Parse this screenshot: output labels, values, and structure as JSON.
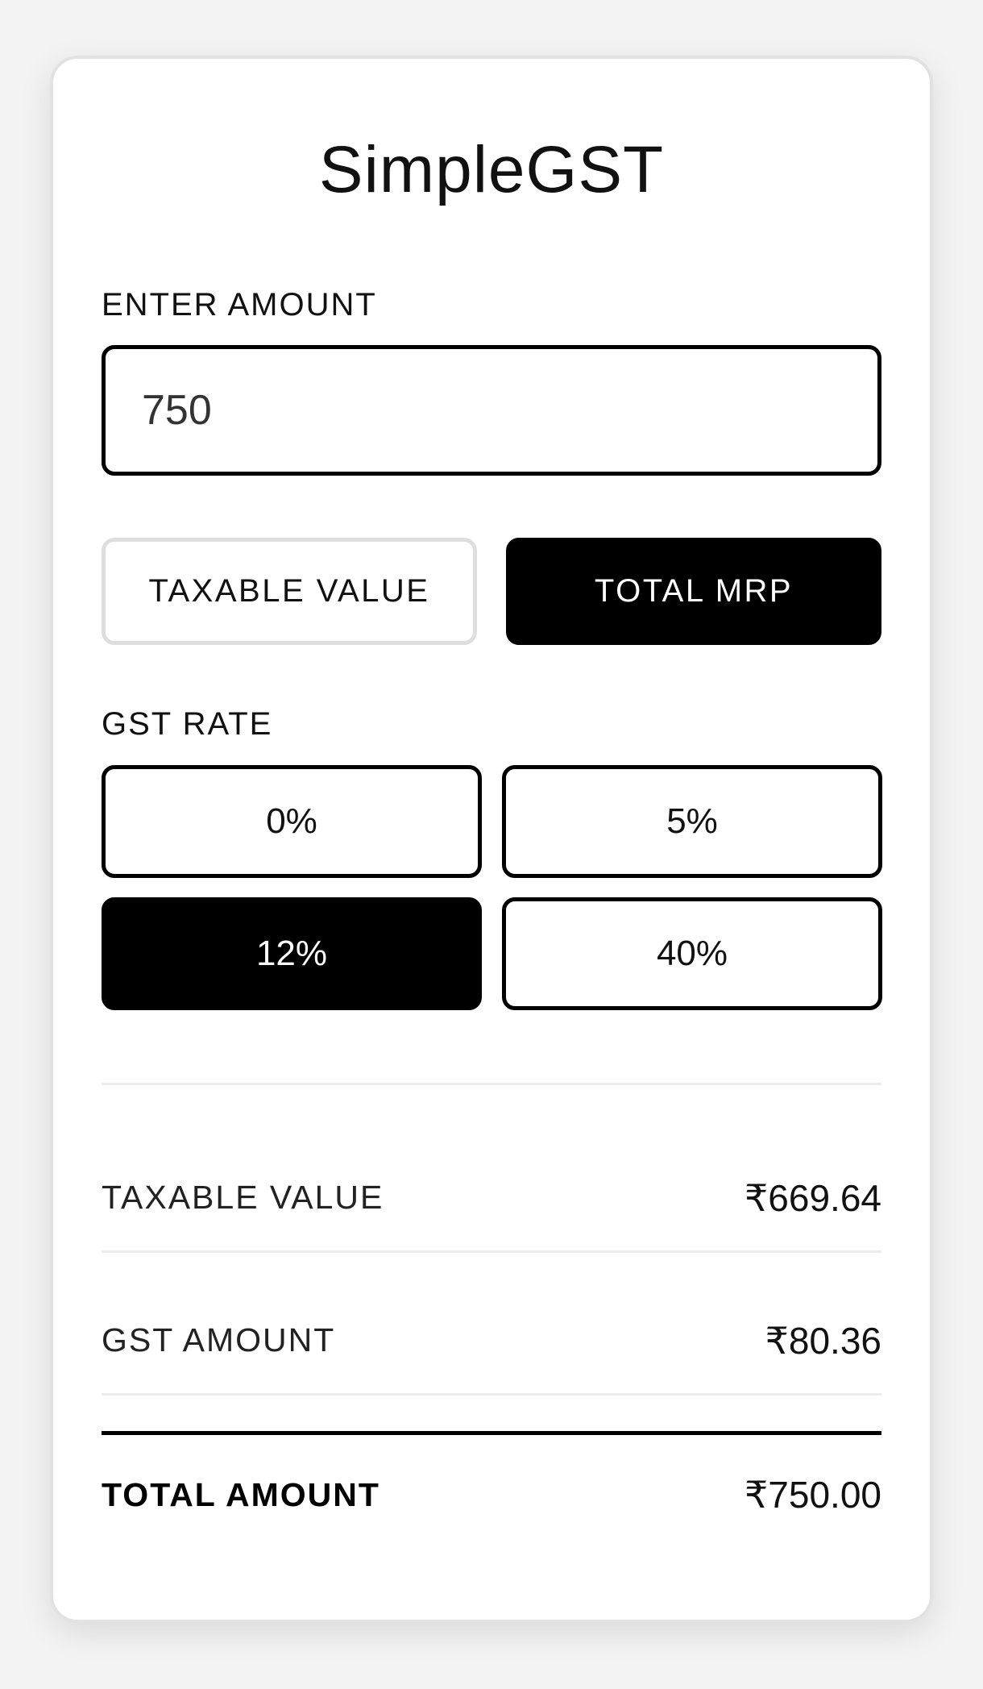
{
  "app": {
    "title": "SimpleGST"
  },
  "amount": {
    "label": "ENTER AMOUNT",
    "value": "750"
  },
  "mode": {
    "options": [
      {
        "label": "TAXABLE VALUE",
        "selected": false
      },
      {
        "label": "TOTAL MRP",
        "selected": true
      }
    ]
  },
  "gst_rate": {
    "label": "GST RATE",
    "options": [
      {
        "label": "0%",
        "selected": false
      },
      {
        "label": "5%",
        "selected": false
      },
      {
        "label": "12%",
        "selected": true
      },
      {
        "label": "40%",
        "selected": false
      }
    ]
  },
  "results": {
    "taxable": {
      "label": "TAXABLE VALUE",
      "value": "₹669.64"
    },
    "gst": {
      "label": "GST AMOUNT",
      "value": "₹80.36"
    },
    "total": {
      "label": "TOTAL AMOUNT",
      "value": "₹750.00"
    }
  },
  "colors": {
    "accent": "#000000",
    "background": "#f3f3f3",
    "card": "#ffffff"
  }
}
